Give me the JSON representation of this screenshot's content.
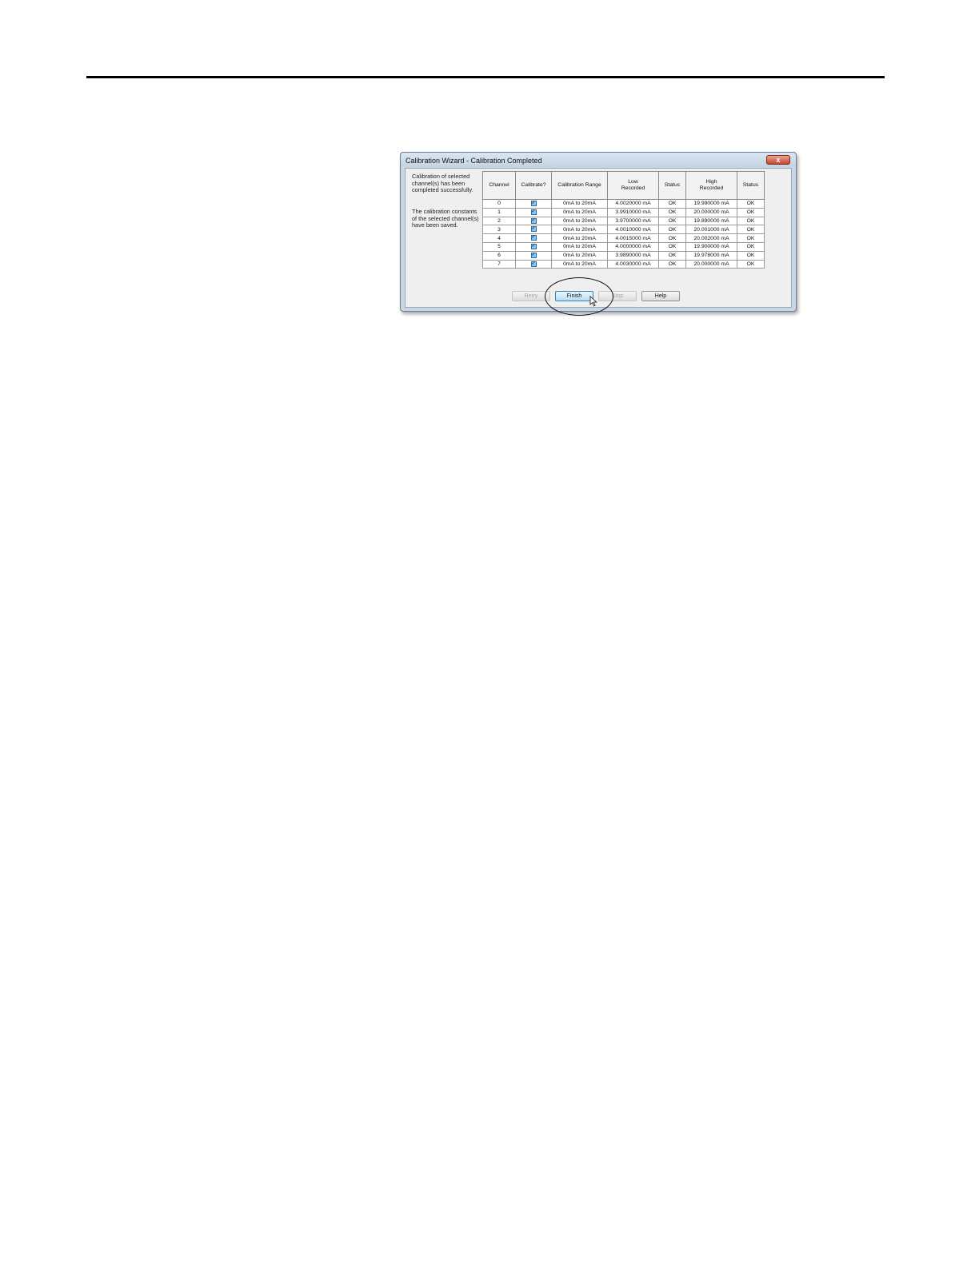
{
  "window": {
    "title": "Calibration Wizard - Calibration Completed",
    "close_glyph": "x"
  },
  "messages": {
    "completed": "Calibration of selected channel(s) has been completed successfully.",
    "saved": "The calibration constants of the selected channel(s) have been saved."
  },
  "table": {
    "headers": {
      "channel": "Channel",
      "calibrate": "Calibrate?",
      "range": "Calibration Range",
      "low_line1": "Low",
      "low_line2": "Recorded",
      "status1": "Status",
      "high_line1": "High",
      "high_line2": "Recorded",
      "status2": "Status"
    },
    "rows": [
      {
        "channel": "0",
        "check": "✓",
        "range": "0mA to 20mA",
        "low": "4.0020000 mA",
        "low_status": "OK",
        "high": "19.990000 mA",
        "high_status": "OK"
      },
      {
        "channel": "1",
        "check": "✓",
        "range": "0mA to 20mA",
        "low": "3.9910000 mA",
        "low_status": "OK",
        "high": "20.000000 mA",
        "high_status": "OK"
      },
      {
        "channel": "2",
        "check": "✓",
        "range": "0mA to 20mA",
        "low": "3.9700000 mA",
        "low_status": "OK",
        "high": "19.890000 mA",
        "high_status": "OK"
      },
      {
        "channel": "3",
        "check": "✓",
        "range": "0mA to 20mA",
        "low": "4.0010000 mA",
        "low_status": "OK",
        "high": "20.001000 mA",
        "high_status": "OK"
      },
      {
        "channel": "4",
        "check": "✓",
        "range": "0mA to 20mA",
        "low": "4.0015000 mA",
        "low_status": "OK",
        "high": "20.002000 mA",
        "high_status": "OK"
      },
      {
        "channel": "5",
        "check": "✓",
        "range": "0mA to 20mA",
        "low": "4.0000000 mA",
        "low_status": "OK",
        "high": "19.900000 mA",
        "high_status": "OK"
      },
      {
        "channel": "6",
        "check": "✓",
        "range": "0mA to 20mA",
        "low": "3.9890000 mA",
        "low_status": "OK",
        "high": "19.978000 mA",
        "high_status": "OK"
      },
      {
        "channel": "7",
        "check": "✓",
        "range": "0mA to 20mA",
        "low": "4.0030000 mA",
        "low_status": "OK",
        "high": "20.000000 mA",
        "high_status": "OK"
      }
    ]
  },
  "buttons": {
    "retry": "Retry",
    "finish": "Finish",
    "stop": "Stop",
    "help": "Help"
  }
}
